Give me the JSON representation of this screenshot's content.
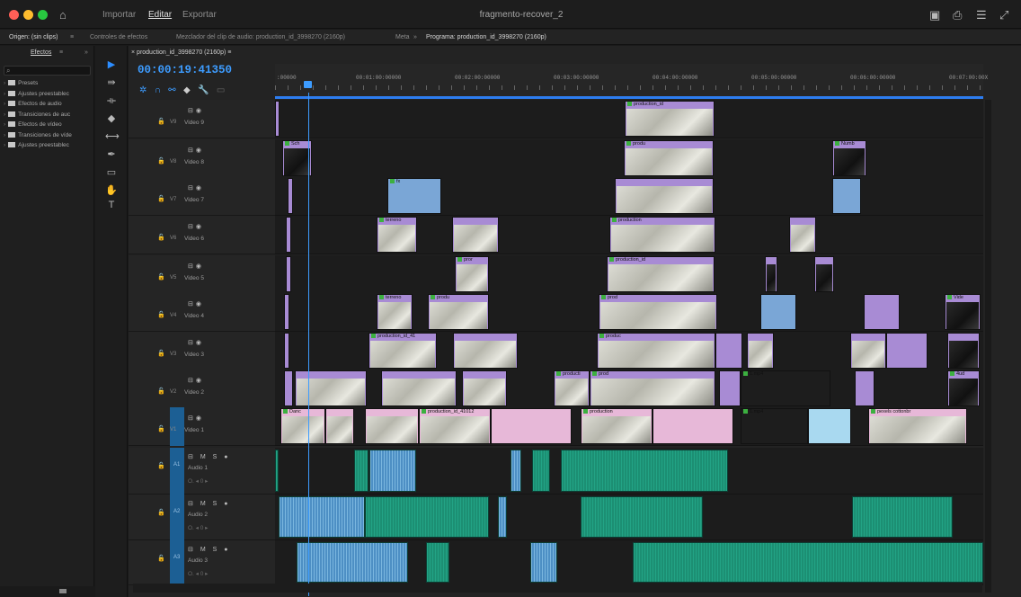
{
  "window": {
    "title": "fragmento-recover_2",
    "tabs": [
      "Importar",
      "Editar",
      "Exportar"
    ],
    "active_tab": "Editar",
    "traffic_lights": [
      "#ff5f57",
      "#febc2e",
      "#28c840"
    ]
  },
  "panel_tabs": {
    "source": "Origen: (sin clips)",
    "effect_controls": "Controles de efectos",
    "audio_mixer": "Mezclador del clip de audio: production_id_3998270 (2160p)",
    "meta": "Meta",
    "program": "Programa: production_id_3998270 (2160p)"
  },
  "effects_panel": {
    "tab": "Efectos",
    "search_icon": "search-icon",
    "items": [
      {
        "label": "Presets",
        "icon": "preset-folder-icon"
      },
      {
        "label": "Ajustes preestablec",
        "icon": "preset-folder-icon"
      },
      {
        "label": "Efectos de audio",
        "icon": "folder-icon"
      },
      {
        "label": "Transiciones de auc",
        "icon": "folder-icon"
      },
      {
        "label": "Efectos de vídeo",
        "icon": "folder-icon"
      },
      {
        "label": "Transiciones de víde",
        "icon": "folder-icon"
      },
      {
        "label": "Ajustes preestablec",
        "icon": "preset-folder-icon"
      }
    ]
  },
  "timeline": {
    "sequence_tab": "production_id_3998270 (2160p)",
    "timecode": "00:00:19:41350",
    "ruler_labels": [
      ":00000",
      "00:01:00:00000",
      "00:02:00:00000",
      "00:03:00:00000",
      "00:04:00:00000",
      "00:05:00:00000",
      "00:06:00:00000",
      "00:07:00:00X"
    ],
    "video_tracks": [
      {
        "code": "V9",
        "name": "Video 9"
      },
      {
        "code": "V8",
        "name": "Video 8"
      },
      {
        "code": "V7",
        "name": "Video 7"
      },
      {
        "code": "V6",
        "name": "Video 6"
      },
      {
        "code": "V5",
        "name": "Video 5"
      },
      {
        "code": "V4",
        "name": "Video 4"
      },
      {
        "code": "V3",
        "name": "Video 3"
      },
      {
        "code": "V2",
        "name": "Video 2"
      },
      {
        "code": "V1",
        "name": "Video 1"
      }
    ],
    "audio_tracks": [
      {
        "code": "A1",
        "name": "Audio 1",
        "controls": "M  S"
      },
      {
        "code": "A2",
        "name": "Audio 2",
        "controls": "M  S"
      },
      {
        "code": "A3",
        "name": "Audio 3",
        "controls": "M  S"
      }
    ],
    "clip_labels": {
      "v9_a": "production_id",
      "v8_a": "Sch",
      "v8_b": "produ",
      "v8_c": "Numb",
      "v7_a": "fx",
      "v6_a": "terreno",
      "v6_b": "production",
      "v5_a": "pror",
      "v5_b": "production_id",
      "v4_a": "terreno",
      "v4_b": "produ",
      "v4_c": "prod",
      "v4_d": "production",
      "v4_e": "Vide",
      "v3_a": "production_id_41",
      "v3_b": "produc",
      "v3_c": "produc",
      "v2_a": "producti",
      "v2_b": "prod",
      "v2_c": "1.mp4",
      "v2_d": "4ud",
      "v1_a": "Danc",
      "v1_b": "production_id_41012",
      "v1_c": "production",
      "v1_d": "1.mp4",
      "v1_e": "pexels cottonbr"
    },
    "colors": {
      "violet": "#a88bd4",
      "pink": "#e7b8d8",
      "blue": "#7aa6d6",
      "green": "#22a385",
      "audio_blue": "#6aa9d8",
      "playhead": "#3d9cff"
    }
  }
}
